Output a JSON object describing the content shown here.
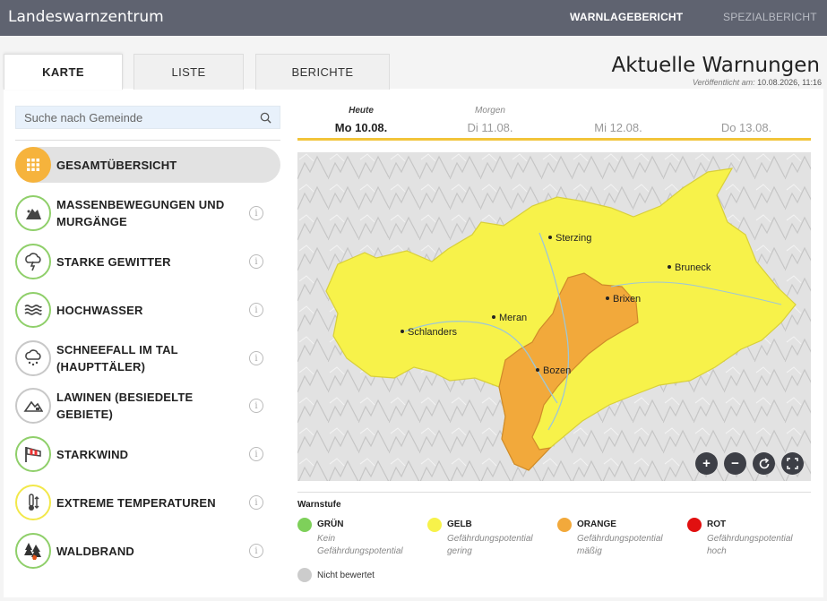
{
  "header": {
    "app_title": "Landeswarnzentrum",
    "nav": [
      "WARNLAGEBERICHT",
      "SPEZIALBERICHT"
    ]
  },
  "tabs": [
    "KARTE",
    "LISTE",
    "BERICHTE"
  ],
  "main": {
    "title": "Aktuelle Warnungen",
    "published_label": "Veröffentlicht am:",
    "published_value": "10.08.2026, 11:16"
  },
  "search": {
    "placeholder": "Suche nach Gemeinde"
  },
  "categories": [
    {
      "line1": "GESAMTÜBERSICHT",
      "line2": "",
      "icon": "grid-icon"
    },
    {
      "line1": "MASSENBEWEGUNGEN UND",
      "line2": "MURGÄNGE",
      "icon": "landslide-icon"
    },
    {
      "line1": "STARKE GEWITTER",
      "line2": "",
      "icon": "thunderstorm-icon"
    },
    {
      "line1": "HOCHWASSER",
      "line2": "",
      "icon": "waves-icon"
    },
    {
      "line1": "SCHNEEFALL IM TAL",
      "line2": "(HAUPTTÄLER)",
      "icon": "snowfall-icon"
    },
    {
      "line1": "LAWINEN (BESIEDELTE GEBIETE)",
      "line2": "",
      "icon": "avalanche-icon"
    },
    {
      "line1": "STARKWIND",
      "line2": "",
      "icon": "windsock-icon"
    },
    {
      "line1": "EXTREME TEMPERATUREN",
      "line2": "",
      "icon": "thermometer-icon"
    },
    {
      "line1": "WALDBRAND",
      "line2": "",
      "icon": "forest-fire-icon"
    }
  ],
  "days": [
    {
      "top": "Heute",
      "main": "Mo 10.08."
    },
    {
      "top": "Morgen",
      "main": "Di 11.08."
    },
    {
      "top": "",
      "main": "Mi 12.08."
    },
    {
      "top": "",
      "main": "Do 13.08."
    }
  ],
  "map": {
    "cities": [
      "Sterzing",
      "Bruneck",
      "Brixen",
      "Meran",
      "Schlanders",
      "Bozen"
    ],
    "colors": {
      "yellow": "#f7f24a",
      "orange": "#f2a93b"
    }
  },
  "legend": {
    "title": "Warnstufe",
    "levels": [
      {
        "name": "GRÜN",
        "desc": "Kein Gefährdungspotential",
        "color": "#7ed05a"
      },
      {
        "name": "GELB",
        "desc": "Gefährdungspotential gering",
        "color": "#f7f24a"
      },
      {
        "name": "ORANGE",
        "desc": "Gefährdungspotential mäßig",
        "color": "#f2a93b"
      },
      {
        "name": "ROT",
        "desc": "Gefährdungspotential hoch",
        "color": "#e11010"
      }
    ],
    "unrated": {
      "name": "Nicht bewertet",
      "color": "#cccccc"
    }
  }
}
